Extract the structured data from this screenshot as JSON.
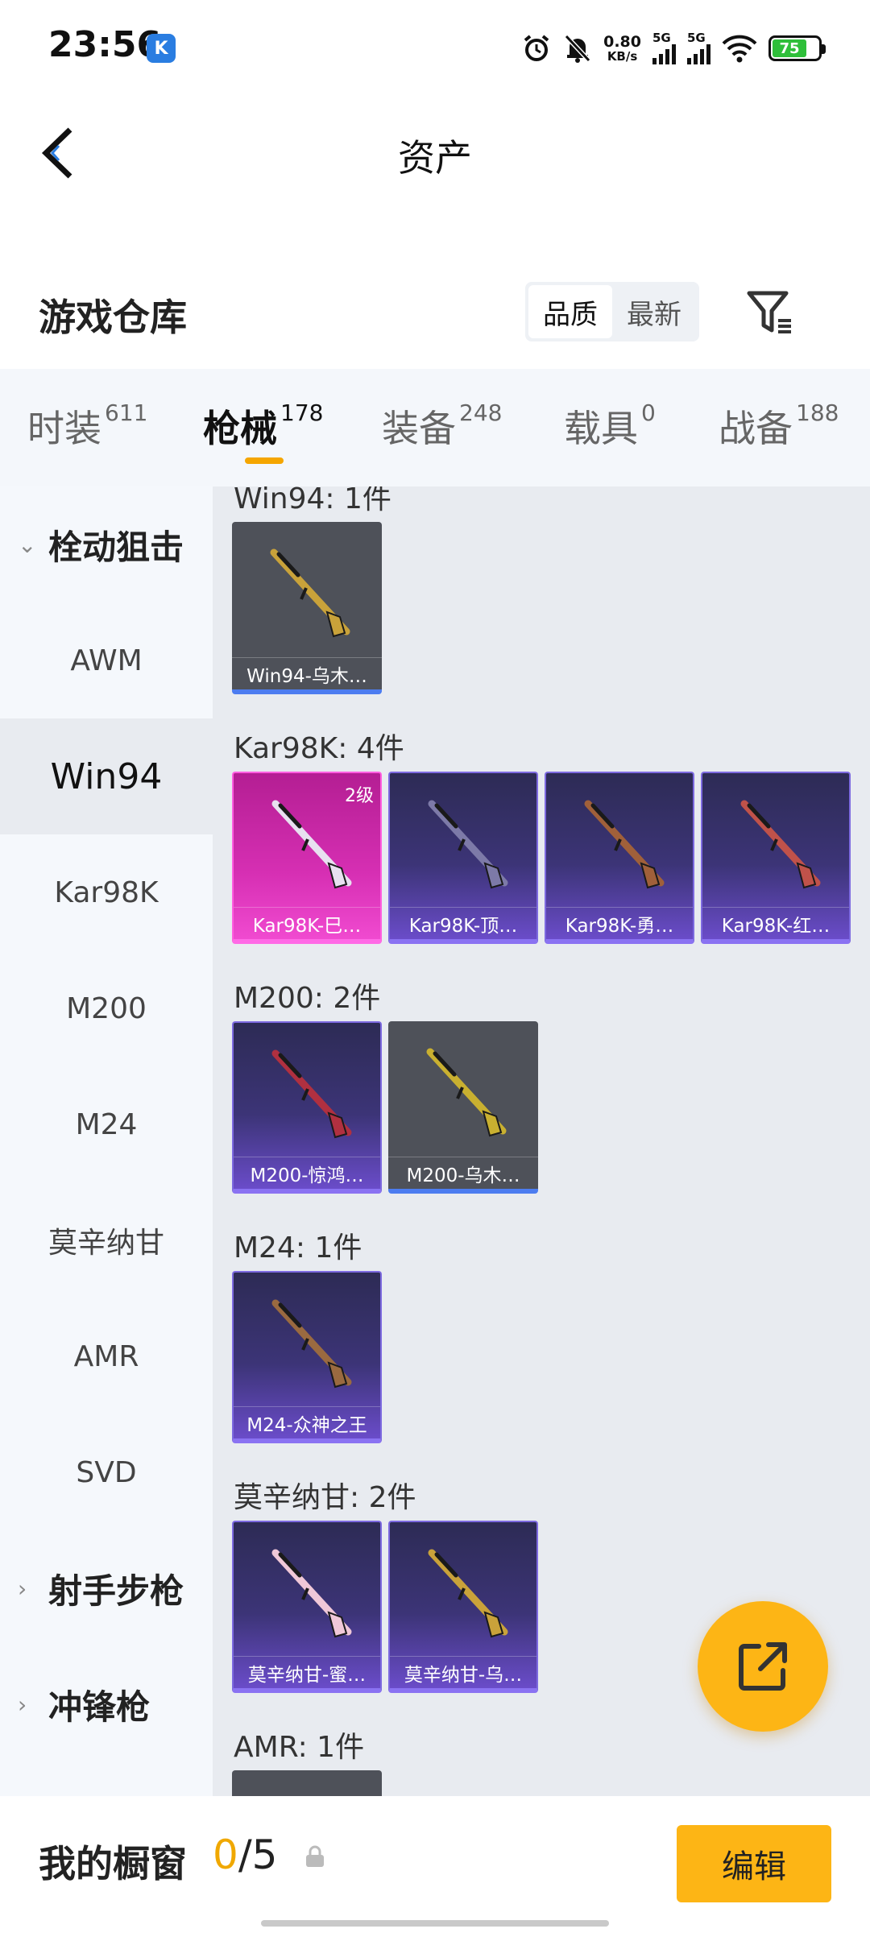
{
  "status_bar": {
    "time": "23:56",
    "app_badge": "K",
    "net_speed_value": "0.80",
    "net_speed_unit": "KB/s",
    "sim1_label": "5G",
    "sim2_label": "5G",
    "battery": "75",
    "icons": [
      "alarm-icon",
      "mute-icon",
      "signal-icon",
      "wifi-icon",
      "battery-icon"
    ]
  },
  "header": {
    "title": "资产",
    "back_icon": "chevron-left-icon"
  },
  "warehouse": {
    "title": "游戏仓库",
    "sort_options": [
      "品质",
      "最新"
    ],
    "active_sort": "品质",
    "filter_icon": "filter-icon"
  },
  "tabs": [
    {
      "label": "时装",
      "count": "611"
    },
    {
      "label": "枪械",
      "count": "178",
      "active": true
    },
    {
      "label": "装备",
      "count": "248"
    },
    {
      "label": "载具",
      "count": "0"
    },
    {
      "label": "战备",
      "count": "188"
    }
  ],
  "sidebar": [
    {
      "label": "栓动狙击",
      "type": "group",
      "expanded": true
    },
    {
      "label": "AWM"
    },
    {
      "label": "Win94",
      "active": true
    },
    {
      "label": "Kar98K"
    },
    {
      "label": "M200"
    },
    {
      "label": "M24"
    },
    {
      "label": "莫辛纳甘"
    },
    {
      "label": "AMR"
    },
    {
      "label": "SVD"
    },
    {
      "label": "射手步枪",
      "type": "group",
      "expanded": false
    },
    {
      "label": "冲锋枪",
      "type": "group",
      "expanded": false
    }
  ],
  "sections": [
    {
      "title": "Win94: 1件",
      "items": [
        {
          "name": "Win94-乌木…",
          "rarity": "grey",
          "gun_color": "#c9a23a"
        }
      ]
    },
    {
      "title": "Kar98K: 4件",
      "items": [
        {
          "name": "Kar98K-巳…",
          "rarity": "pink",
          "level": "2级",
          "gun_color": "#e8e0f0"
        },
        {
          "name": "Kar98K-顶…",
          "rarity": "purple",
          "gun_color": "#7d7aa8"
        },
        {
          "name": "Kar98K-勇…",
          "rarity": "purple",
          "gun_color": "#a0603a"
        },
        {
          "name": "Kar98K-红…",
          "rarity": "purple",
          "gun_color": "#c0524a"
        }
      ]
    },
    {
      "title": "M200: 2件",
      "items": [
        {
          "name": "M200-惊鸿…",
          "rarity": "purple",
          "gun_color": "#b03040"
        },
        {
          "name": "M200-乌木…",
          "rarity": "grey",
          "gun_color": "#c9b030"
        }
      ]
    },
    {
      "title": "M24: 1件",
      "items": [
        {
          "name": "M24-众神之王",
          "rarity": "purple",
          "gun_color": "#9a6a40"
        }
      ]
    },
    {
      "title": "莫辛纳甘: 2件",
      "items": [
        {
          "name": "莫辛纳甘-蜜…",
          "rarity": "purple",
          "gun_color": "#f0c8d8"
        },
        {
          "name": "莫辛纳甘-乌…",
          "rarity": "purple",
          "gun_color": "#c9a23a"
        }
      ]
    },
    {
      "title": "AMR: 1件",
      "items": [
        {
          "name": "",
          "rarity": "grey",
          "gun_color": "#c9a23a"
        }
      ]
    }
  ],
  "share_button_icon": "share-external-icon",
  "showcase": {
    "label": "我的橱窗",
    "current": "0",
    "separator": "/",
    "max": "5",
    "lock_icon": "lock-icon",
    "edit_label": "编辑"
  },
  "colors": {
    "accent": "#fdb515",
    "tab_underline": "#f5a600",
    "rarity_grey_border": "#4c7cf0",
    "rarity_purple_border": "#8a72f2",
    "rarity_pink_border": "#ff6ae6"
  }
}
